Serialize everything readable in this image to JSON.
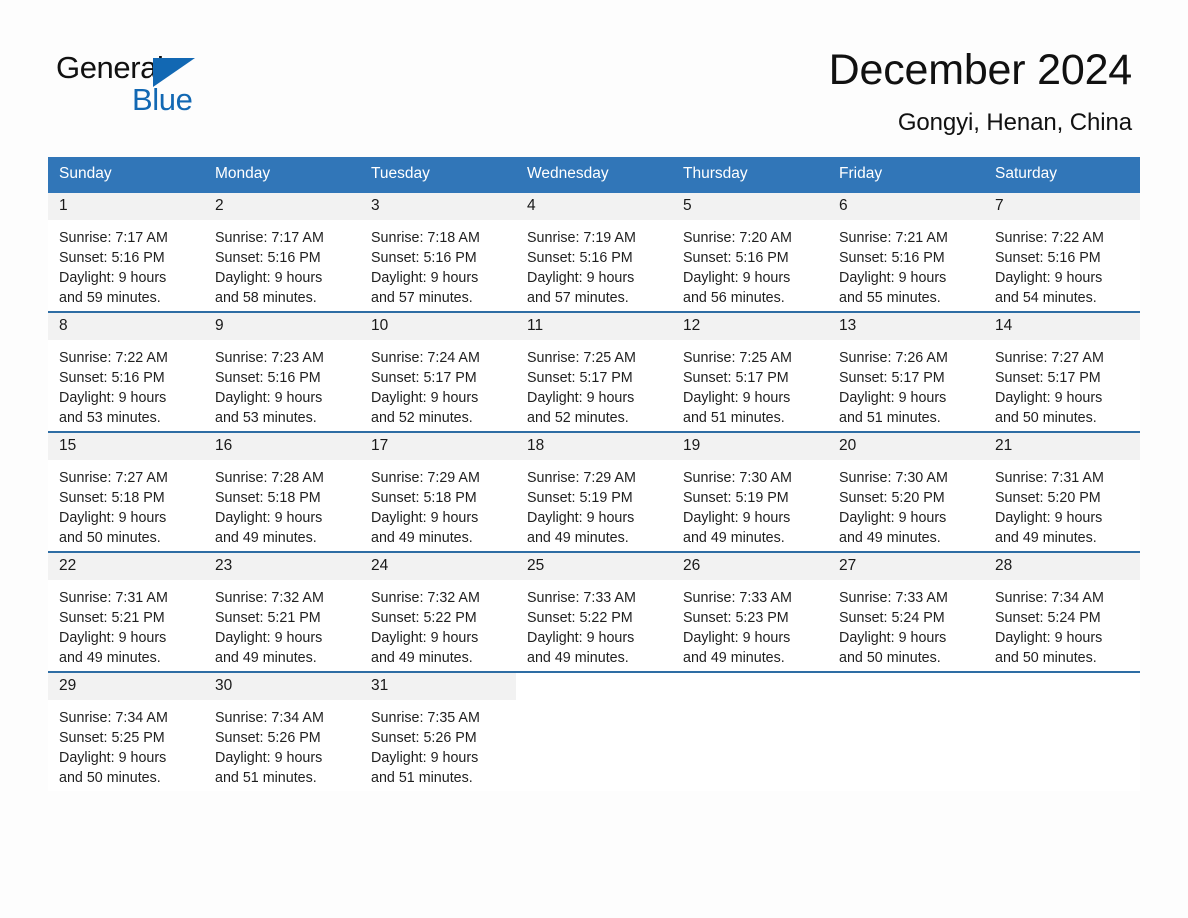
{
  "brand": {
    "name_part1": "General",
    "name_part2": "Blue",
    "triangle_color": "#1268b3",
    "accent_color": "#3176b8"
  },
  "header": {
    "title": "December 2024",
    "subtitle": "Gongyi, Henan, China"
  },
  "weekdays": [
    "Sunday",
    "Monday",
    "Tuesday",
    "Wednesday",
    "Thursday",
    "Friday",
    "Saturday"
  ],
  "weeks": [
    [
      {
        "day": "1",
        "sunrise": "Sunrise: 7:17 AM",
        "sunset": "Sunset: 5:16 PM",
        "daylight1": "Daylight: 9 hours",
        "daylight2": "and 59 minutes."
      },
      {
        "day": "2",
        "sunrise": "Sunrise: 7:17 AM",
        "sunset": "Sunset: 5:16 PM",
        "daylight1": "Daylight: 9 hours",
        "daylight2": "and 58 minutes."
      },
      {
        "day": "3",
        "sunrise": "Sunrise: 7:18 AM",
        "sunset": "Sunset: 5:16 PM",
        "daylight1": "Daylight: 9 hours",
        "daylight2": "and 57 minutes."
      },
      {
        "day": "4",
        "sunrise": "Sunrise: 7:19 AM",
        "sunset": "Sunset: 5:16 PM",
        "daylight1": "Daylight: 9 hours",
        "daylight2": "and 57 minutes."
      },
      {
        "day": "5",
        "sunrise": "Sunrise: 7:20 AM",
        "sunset": "Sunset: 5:16 PM",
        "daylight1": "Daylight: 9 hours",
        "daylight2": "and 56 minutes."
      },
      {
        "day": "6",
        "sunrise": "Sunrise: 7:21 AM",
        "sunset": "Sunset: 5:16 PM",
        "daylight1": "Daylight: 9 hours",
        "daylight2": "and 55 minutes."
      },
      {
        "day": "7",
        "sunrise": "Sunrise: 7:22 AM",
        "sunset": "Sunset: 5:16 PM",
        "daylight1": "Daylight: 9 hours",
        "daylight2": "and 54 minutes."
      }
    ],
    [
      {
        "day": "8",
        "sunrise": "Sunrise: 7:22 AM",
        "sunset": "Sunset: 5:16 PM",
        "daylight1": "Daylight: 9 hours",
        "daylight2": "and 53 minutes."
      },
      {
        "day": "9",
        "sunrise": "Sunrise: 7:23 AM",
        "sunset": "Sunset: 5:16 PM",
        "daylight1": "Daylight: 9 hours",
        "daylight2": "and 53 minutes."
      },
      {
        "day": "10",
        "sunrise": "Sunrise: 7:24 AM",
        "sunset": "Sunset: 5:17 PM",
        "daylight1": "Daylight: 9 hours",
        "daylight2": "and 52 minutes."
      },
      {
        "day": "11",
        "sunrise": "Sunrise: 7:25 AM",
        "sunset": "Sunset: 5:17 PM",
        "daylight1": "Daylight: 9 hours",
        "daylight2": "and 52 minutes."
      },
      {
        "day": "12",
        "sunrise": "Sunrise: 7:25 AM",
        "sunset": "Sunset: 5:17 PM",
        "daylight1": "Daylight: 9 hours",
        "daylight2": "and 51 minutes."
      },
      {
        "day": "13",
        "sunrise": "Sunrise: 7:26 AM",
        "sunset": "Sunset: 5:17 PM",
        "daylight1": "Daylight: 9 hours",
        "daylight2": "and 51 minutes."
      },
      {
        "day": "14",
        "sunrise": "Sunrise: 7:27 AM",
        "sunset": "Sunset: 5:17 PM",
        "daylight1": "Daylight: 9 hours",
        "daylight2": "and 50 minutes."
      }
    ],
    [
      {
        "day": "15",
        "sunrise": "Sunrise: 7:27 AM",
        "sunset": "Sunset: 5:18 PM",
        "daylight1": "Daylight: 9 hours",
        "daylight2": "and 50 minutes."
      },
      {
        "day": "16",
        "sunrise": "Sunrise: 7:28 AM",
        "sunset": "Sunset: 5:18 PM",
        "daylight1": "Daylight: 9 hours",
        "daylight2": "and 49 minutes."
      },
      {
        "day": "17",
        "sunrise": "Sunrise: 7:29 AM",
        "sunset": "Sunset: 5:18 PM",
        "daylight1": "Daylight: 9 hours",
        "daylight2": "and 49 minutes."
      },
      {
        "day": "18",
        "sunrise": "Sunrise: 7:29 AM",
        "sunset": "Sunset: 5:19 PM",
        "daylight1": "Daylight: 9 hours",
        "daylight2": "and 49 minutes."
      },
      {
        "day": "19",
        "sunrise": "Sunrise: 7:30 AM",
        "sunset": "Sunset: 5:19 PM",
        "daylight1": "Daylight: 9 hours",
        "daylight2": "and 49 minutes."
      },
      {
        "day": "20",
        "sunrise": "Sunrise: 7:30 AM",
        "sunset": "Sunset: 5:20 PM",
        "daylight1": "Daylight: 9 hours",
        "daylight2": "and 49 minutes."
      },
      {
        "day": "21",
        "sunrise": "Sunrise: 7:31 AM",
        "sunset": "Sunset: 5:20 PM",
        "daylight1": "Daylight: 9 hours",
        "daylight2": "and 49 minutes."
      }
    ],
    [
      {
        "day": "22",
        "sunrise": "Sunrise: 7:31 AM",
        "sunset": "Sunset: 5:21 PM",
        "daylight1": "Daylight: 9 hours",
        "daylight2": "and 49 minutes."
      },
      {
        "day": "23",
        "sunrise": "Sunrise: 7:32 AM",
        "sunset": "Sunset: 5:21 PM",
        "daylight1": "Daylight: 9 hours",
        "daylight2": "and 49 minutes."
      },
      {
        "day": "24",
        "sunrise": "Sunrise: 7:32 AM",
        "sunset": "Sunset: 5:22 PM",
        "daylight1": "Daylight: 9 hours",
        "daylight2": "and 49 minutes."
      },
      {
        "day": "25",
        "sunrise": "Sunrise: 7:33 AM",
        "sunset": "Sunset: 5:22 PM",
        "daylight1": "Daylight: 9 hours",
        "daylight2": "and 49 minutes."
      },
      {
        "day": "26",
        "sunrise": "Sunrise: 7:33 AM",
        "sunset": "Sunset: 5:23 PM",
        "daylight1": "Daylight: 9 hours",
        "daylight2": "and 49 minutes."
      },
      {
        "day": "27",
        "sunrise": "Sunrise: 7:33 AM",
        "sunset": "Sunset: 5:24 PM",
        "daylight1": "Daylight: 9 hours",
        "daylight2": "and 50 minutes."
      },
      {
        "day": "28",
        "sunrise": "Sunrise: 7:34 AM",
        "sunset": "Sunset: 5:24 PM",
        "daylight1": "Daylight: 9 hours",
        "daylight2": "and 50 minutes."
      }
    ],
    [
      {
        "day": "29",
        "sunrise": "Sunrise: 7:34 AM",
        "sunset": "Sunset: 5:25 PM",
        "daylight1": "Daylight: 9 hours",
        "daylight2": "and 50 minutes."
      },
      {
        "day": "30",
        "sunrise": "Sunrise: 7:34 AM",
        "sunset": "Sunset: 5:26 PM",
        "daylight1": "Daylight: 9 hours",
        "daylight2": "and 51 minutes."
      },
      {
        "day": "31",
        "sunrise": "Sunrise: 7:35 AM",
        "sunset": "Sunset: 5:26 PM",
        "daylight1": "Daylight: 9 hours",
        "daylight2": "and 51 minutes."
      },
      {
        "day": "",
        "sunrise": "",
        "sunset": "",
        "daylight1": "",
        "daylight2": ""
      },
      {
        "day": "",
        "sunrise": "",
        "sunset": "",
        "daylight1": "",
        "daylight2": ""
      },
      {
        "day": "",
        "sunrise": "",
        "sunset": "",
        "daylight1": "",
        "daylight2": ""
      },
      {
        "day": "",
        "sunrise": "",
        "sunset": "",
        "daylight1": "",
        "daylight2": ""
      }
    ]
  ]
}
